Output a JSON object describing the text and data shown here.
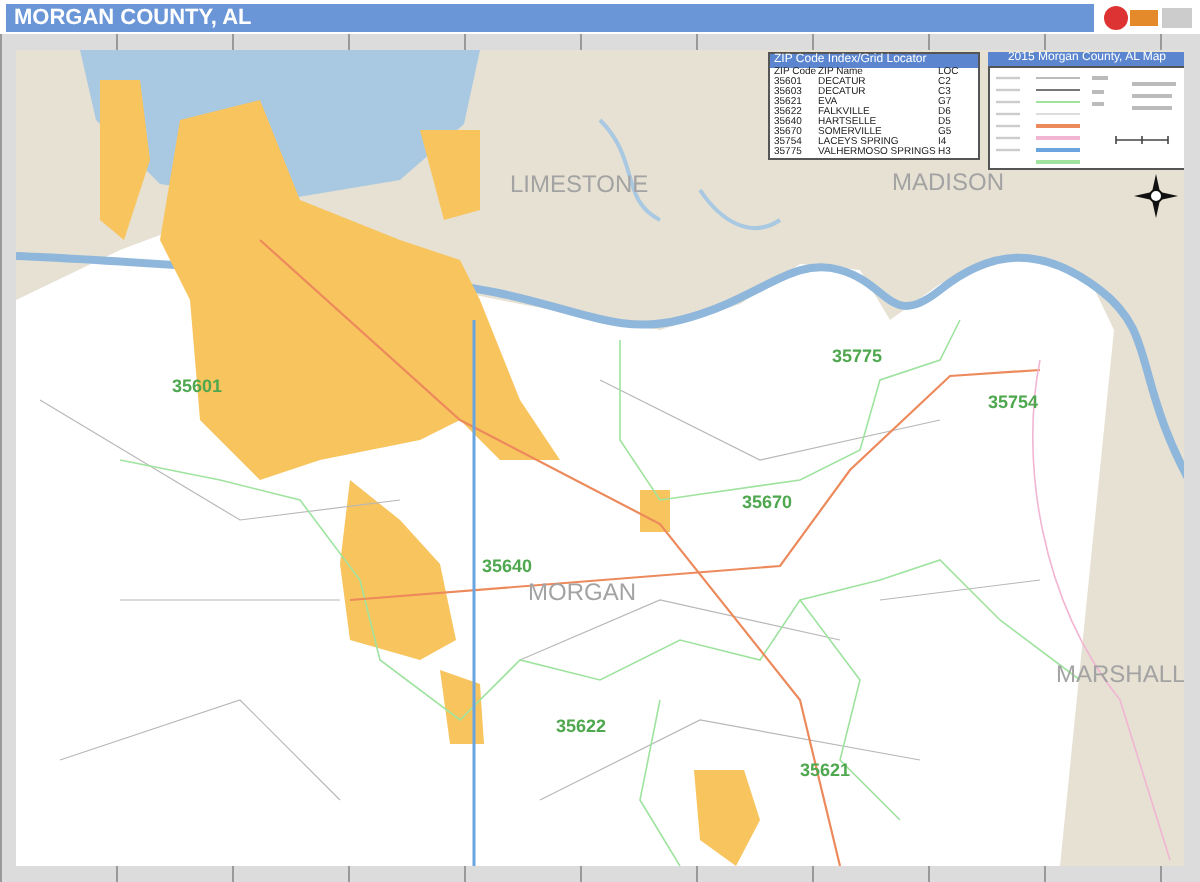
{
  "header": {
    "title": "MORGAN COUNTY, AL"
  },
  "zip_index": {
    "title": "ZIP Code Index/Grid Locator",
    "columns": [
      "ZIP Code",
      "ZIP Name",
      "LOC"
    ],
    "rows": [
      [
        "35601",
        "DECATUR",
        "C2"
      ],
      [
        "35603",
        "DECATUR",
        "C3"
      ],
      [
        "35621",
        "EVA",
        "G7"
      ],
      [
        "35622",
        "FALKVILLE",
        "D6"
      ],
      [
        "35640",
        "HARTSELLE",
        "D5"
      ],
      [
        "35670",
        "SOMERVILLE",
        "G5"
      ],
      [
        "35754",
        "LACEYS SPRING",
        "I4"
      ],
      [
        "35775",
        "VALHERMOSO SPRINGS",
        "H3"
      ]
    ]
  },
  "legend": {
    "title": "2015 Morgan County, AL Map"
  },
  "map": {
    "county_labels": [
      "LIMESTONE",
      "MADISON",
      "MORGAN",
      "MARSHALL"
    ],
    "zip_labels": [
      "35601",
      "35775",
      "35754",
      "35670",
      "35640",
      "35622",
      "35621"
    ]
  }
}
